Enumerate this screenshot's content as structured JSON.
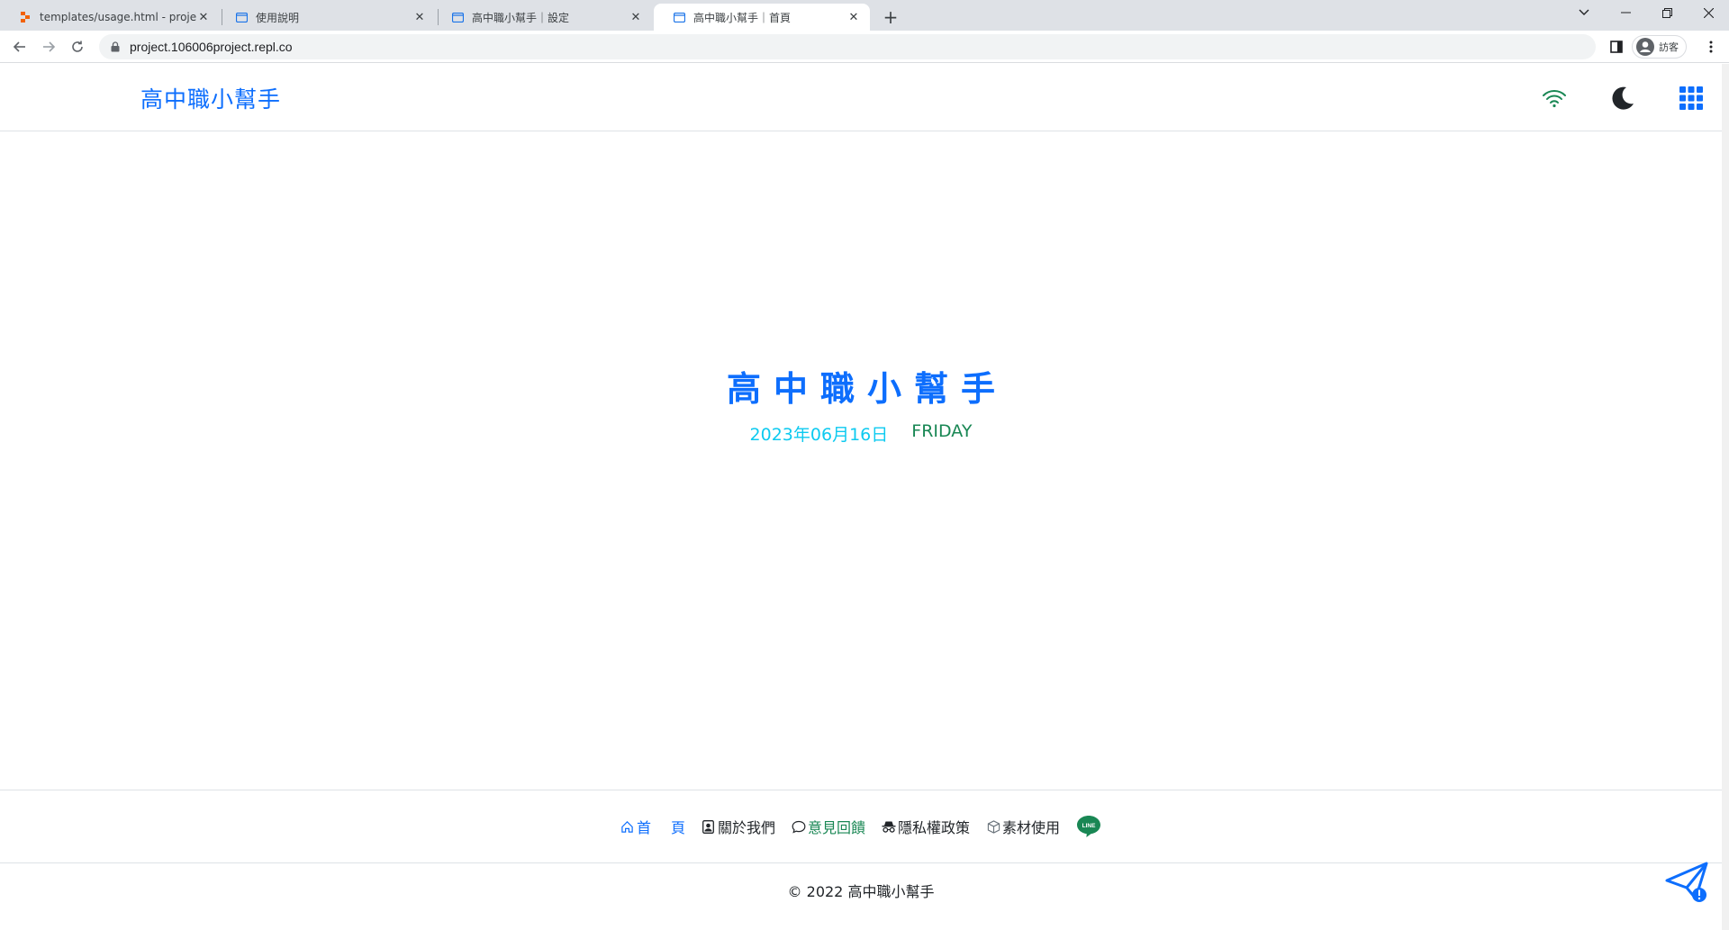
{
  "browser": {
    "tabs": [
      {
        "title": "templates/usage.html - project",
        "active": false,
        "favicon": "replit-logo-icon"
      },
      {
        "title": "使用說明",
        "active": false,
        "favicon": "page-icon"
      },
      {
        "title": "高中職小幫手｜設定",
        "active": false,
        "favicon": "page-icon"
      },
      {
        "title": "高中職小幫手｜首頁",
        "active": true,
        "favicon": "page-icon"
      }
    ],
    "url": "project.106006project.repl.co",
    "profile_label": "訪客"
  },
  "header": {
    "brand": "高中職小幫手",
    "icons": [
      "wifi-icon",
      "moon-icon",
      "grid-menu-icon"
    ],
    "colors": {
      "brand": "#0d6efd",
      "wifi": "#198754",
      "moon": "#212529",
      "grid": "#0d6efd"
    }
  },
  "hero": {
    "title": "高中職小幫手",
    "date": "2023年06月16日",
    "weekday": "FRIDAY",
    "colors": {
      "title": "#0d6efd",
      "date": "#0dcaf0",
      "weekday": "#198754"
    }
  },
  "footer": {
    "links": {
      "home_a": "首",
      "home_b": "頁",
      "about": "關於我們",
      "feedback": "意見回饋",
      "privacy": "隱私權政策",
      "assets": "素材使用",
      "line": "LINE"
    },
    "copyright": "© 2022 高中職小幫手"
  }
}
